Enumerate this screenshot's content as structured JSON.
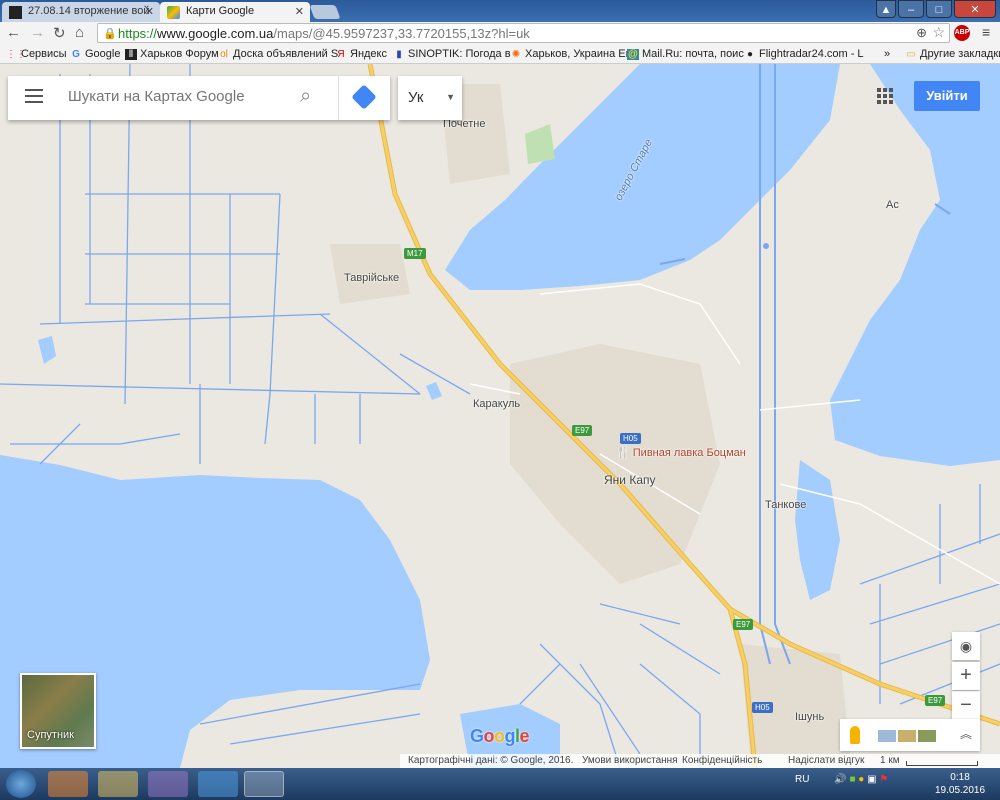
{
  "browser": {
    "tabs": [
      {
        "title": "27.08.14 вторжение вой",
        "active": false
      },
      {
        "title": "Карти Google",
        "active": true
      }
    ],
    "url": {
      "scheme": "https://",
      "host": "www.google.com.ua",
      "path": "/maps/@45.9597237,33.7720155,13z?hl=uk"
    },
    "bookmarks": [
      "Сервисы",
      "Google",
      "Харьков Форум",
      "Доска объявлений S",
      "Яндекс",
      "SINOPTIK: Погода в",
      "Харьков, Украина En",
      "Mail.Ru: почта, поис",
      "Flightradar24.com - L"
    ],
    "other_bookmarks": "Другие закладки",
    "more": "»",
    "abp": "ABP"
  },
  "maps": {
    "search_placeholder": "Шукати на Картах Google",
    "language": "Ук",
    "signin": "Увійти",
    "satellite": "Супутник",
    "logo": "Google",
    "footer": {
      "data": "Картографічні дані: © Google, 2016.",
      "terms": "Умови використання",
      "privacy": "Конфіденційність",
      "feedback": "Надіслати відгук",
      "scale": "1 км"
    },
    "places": [
      "Почетне",
      "озеро Старе",
      "Ас",
      "Таврійське",
      "Каракуль",
      "Пивная лавка Боцман",
      "Яни Капу",
      "Танкове",
      "Ішунь"
    ],
    "road_shields": {
      "m17": "M17",
      "e97": "E97",
      "h05": "H05"
    },
    "colors": {
      "water": "#a3ccff",
      "land": "#eae8e0",
      "highway": "#f6cf65",
      "canal": "#7ba7f0",
      "accent": "#4285f4"
    }
  },
  "taskbar": {
    "lang": "RU",
    "time": "0:18",
    "date": "19.05.2016"
  }
}
